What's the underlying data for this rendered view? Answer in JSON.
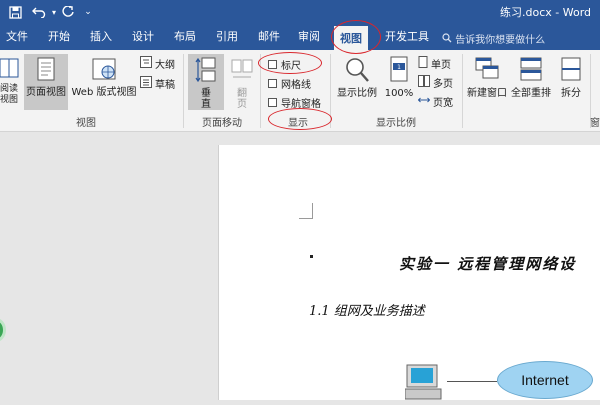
{
  "quick_access": {
    "save_icon": "save-icon",
    "undo_icon": "undo-icon",
    "redo_icon": "redo-icon",
    "customize_icon": "customize-icon"
  },
  "window": {
    "title": "练习.docx - Word"
  },
  "tabs": [
    {
      "label": "文件"
    },
    {
      "label": "开始"
    },
    {
      "label": "插入"
    },
    {
      "label": "设计"
    },
    {
      "label": "布局"
    },
    {
      "label": "引用"
    },
    {
      "label": "邮件"
    },
    {
      "label": "审阅"
    },
    {
      "label": "视图",
      "active": true
    },
    {
      "label": "开发工具"
    }
  ],
  "tell_me": {
    "placeholder": "告诉我你想要做什么"
  },
  "ribbon": {
    "views": {
      "label": "视图",
      "read_mode": "阅读视图",
      "print_layout": "页面视图",
      "web_layout": "Web 版式视图",
      "outline": "大纲",
      "draft": "草稿"
    },
    "page_movement": {
      "label": "页面移动",
      "vertical": "垂直",
      "side_to_side": "翻页"
    },
    "show": {
      "label": "显示",
      "ruler": "标尺",
      "gridlines": "网格线",
      "navigation_pane": "导航窗格"
    },
    "zoom": {
      "label": "显示比例",
      "zoom": "显示比例",
      "hundred": "100%",
      "one_page": "单页",
      "multiple_pages": "多页",
      "page_width": "页宽"
    },
    "window": {
      "label": "窗",
      "new_window": "新建窗口",
      "arrange_all": "全部重排",
      "split": "拆分"
    }
  },
  "document": {
    "title": "实验一  远程管理网络设",
    "section": "1.1  组网及业务描述",
    "internet_label": "Internet"
  },
  "colors": {
    "accent": "#2b579a",
    "annotation": "#d9262c",
    "cloud": "#9fd3f2"
  }
}
